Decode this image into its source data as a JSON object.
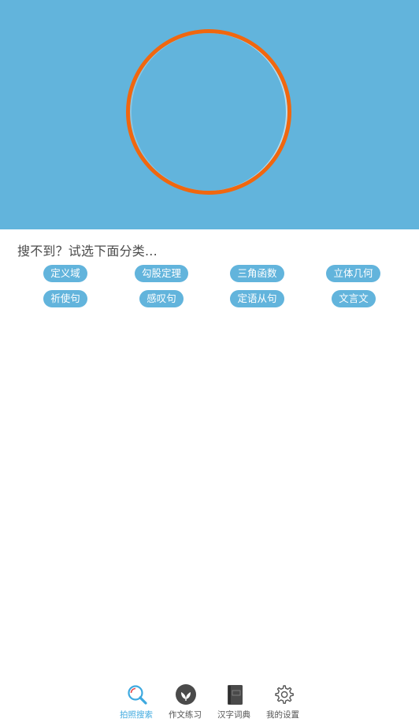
{
  "search_prompt": "搜不到？试选下面分类...",
  "categories": [
    "定义域",
    "勾股定理",
    "三角函数",
    "立体几何",
    "祈使句",
    "感叹句",
    "定语从句",
    "文言文"
  ],
  "tabs": [
    {
      "label": "拍照搜索",
      "icon": "magnifier-icon",
      "active": true
    },
    {
      "label": "作文练习",
      "icon": "leaf-icon",
      "active": false
    },
    {
      "label": "汉字词典",
      "icon": "dictionary-book-icon",
      "active": false
    },
    {
      "label": "我的设置",
      "icon": "gear-icon",
      "active": false
    }
  ],
  "colors": {
    "hero_background": "#62b4dc",
    "shutter_ring": "#f0670f",
    "chip_background": "#62b4dc",
    "active_tab": "#3ea9df"
  }
}
